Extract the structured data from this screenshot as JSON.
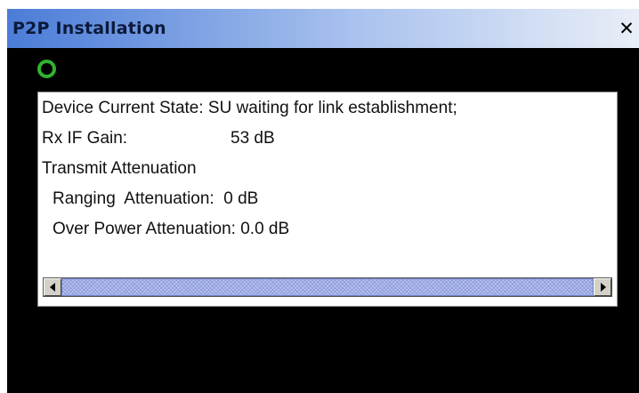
{
  "window": {
    "title": "P2P Installation",
    "close_glyph": "✕",
    "close_icon": "close-icon"
  },
  "status_indicator": {
    "icon": "status-ring-icon",
    "color": "#2fb52f"
  },
  "info_panel": {
    "device_state": "Device Current State: SU waiting for link establishment;",
    "rx_if_gain_label": "Rx IF Gain:",
    "rx_if_gain_value": "53 dB",
    "transmit_attenuation_heading": "Transmit Attenuation",
    "ranging_attenuation": "Ranging  Attenuation:  0 dB",
    "over_power_attenuation": "Over Power Attenuation: 0.0 dB"
  },
  "scrollbar": {
    "left_icon": "arrow-left-icon",
    "right_icon": "arrow-right-icon"
  },
  "colors": {
    "titlebar_start": "#4b7cd8",
    "titlebar_end": "#e9eef7",
    "window_background": "#000000",
    "panel_background": "#ffffff",
    "scroll_thumb": "#b9c3ee"
  }
}
